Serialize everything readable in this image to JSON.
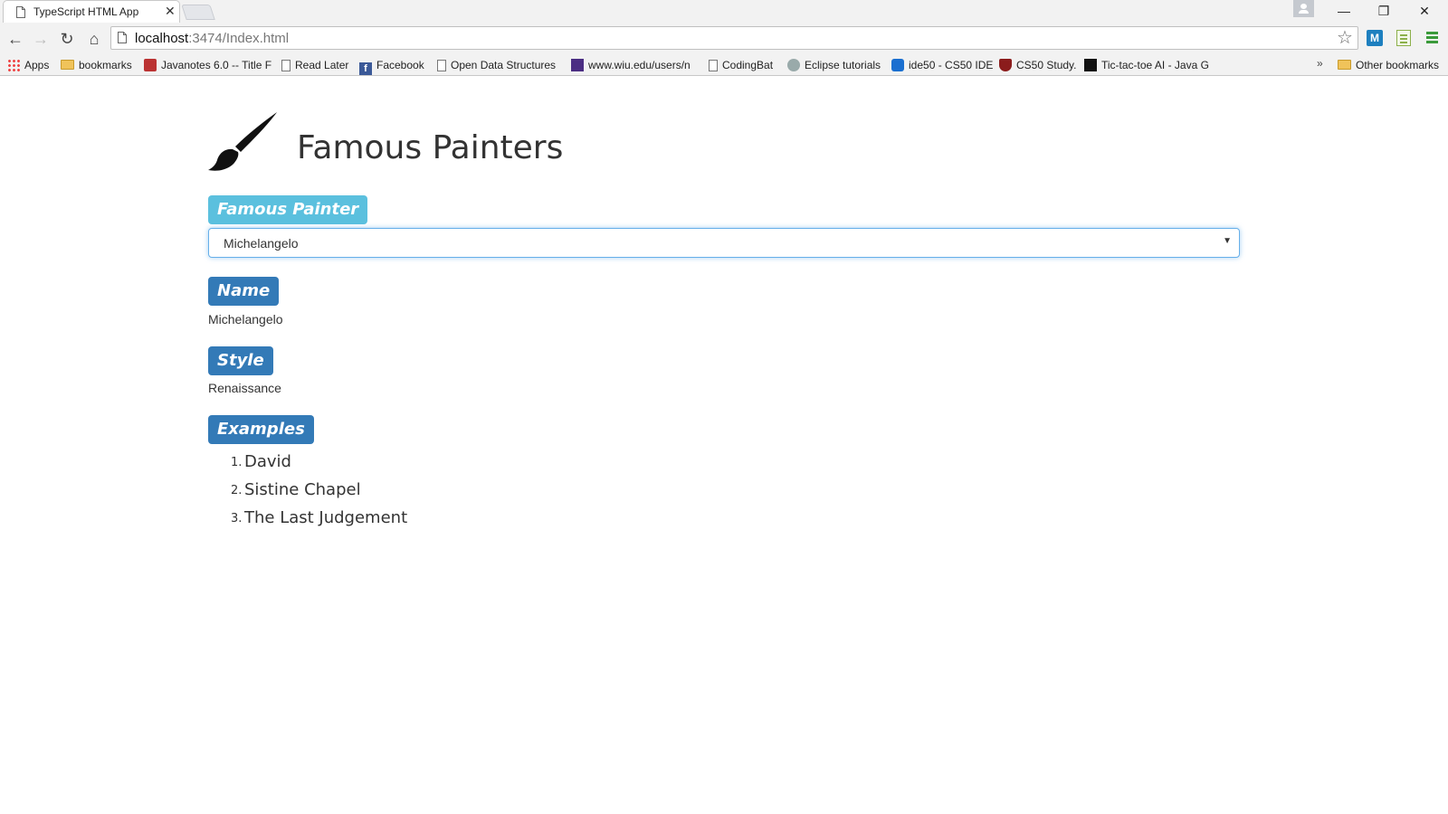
{
  "browser": {
    "tab_title": "TypeScript HTML App",
    "url_host": "localhost",
    "url_rest": ":3474/Index.html",
    "ext_m_label": "M",
    "bookmarks": [
      {
        "label": "Apps",
        "icon": "apps-icon"
      },
      {
        "label": "bookmarks",
        "icon": "folder-icon"
      },
      {
        "label": "Javanotes 6.0 -- Title F",
        "icon": "javanotes-icon"
      },
      {
        "label": "Read Later",
        "icon": "page-icon"
      },
      {
        "label": "Facebook",
        "icon": "facebook-icon"
      },
      {
        "label": "Open Data Structures",
        "icon": "page-icon"
      },
      {
        "label": "www.wiu.edu/users/n",
        "icon": "wiu-icon"
      },
      {
        "label": "CodingBat",
        "icon": "page-icon"
      },
      {
        "label": "Eclipse tutorials",
        "icon": "globe-icon"
      },
      {
        "label": "ide50 - CS50 IDE",
        "icon": "ide50-icon"
      },
      {
        "label": "CS50 Study.",
        "icon": "harvard-shield-icon"
      },
      {
        "label": "Tic-tac-toe AI - Java G",
        "icon": "terminal-icon"
      }
    ],
    "overflow_label": "»",
    "other_bookmarks": "Other bookmarks"
  },
  "page": {
    "title": "Famous Painters",
    "select_label": "Famous Painter",
    "selected_painter": "Michelangelo",
    "name_label": "Name",
    "name_value": "Michelangelo",
    "style_label": "Style",
    "style_value": "Renaissance",
    "examples_label": "Examples",
    "examples": [
      "David",
      "Sistine Chapel",
      "The Last Judgement"
    ]
  },
  "colors": {
    "label_info": "#5bc0de",
    "label_primary": "#337ab7",
    "focus_border": "#66afe9"
  }
}
